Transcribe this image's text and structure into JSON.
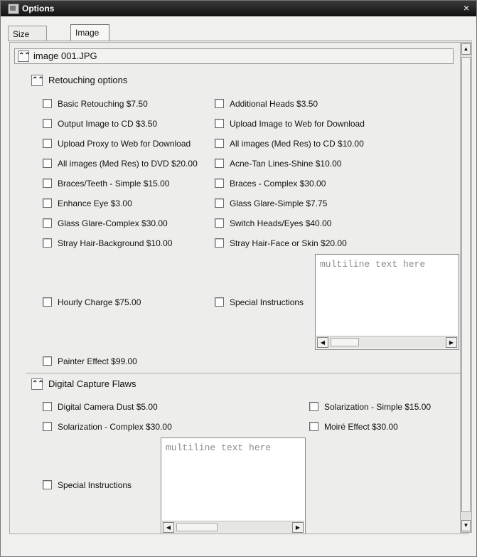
{
  "window": {
    "title": "Options",
    "close_symbol": "×"
  },
  "tabs": [
    {
      "label": "Size Options",
      "active": false
    },
    {
      "label": "Image Options",
      "active": true
    }
  ],
  "image_section": {
    "title": "image 001.JPG"
  },
  "retouching": {
    "title": "Retouching options",
    "left_options": [
      "Basic Retouching $7.50",
      "Output Image to CD $3.50",
      "Upload Proxy to Web for Download",
      "All images (Med Res) to DVD $20.00",
      "Braces/Teeth - Simple $15.00",
      "Enhance Eye $3.00",
      "Glass Glare-Complex $30.00",
      "Stray Hair-Background $10.00"
    ],
    "right_options": [
      "Additional Heads $3.50",
      "Upload Image to Web for Download",
      "All images (Med Res) to CD $10.00",
      "Acne-Tan Lines-Shine $10.00",
      "Braces - Complex $30.00",
      "Glass Glare-Simple $7.75",
      "Switch Heads/Eyes $40.00",
      "Stray Hair-Face or Skin $20.00"
    ],
    "hourly_charge": "Hourly Charge $75.00",
    "special_instructions": "Special Instructions",
    "special_placeholder": "multiline text here",
    "painter_effect": "Painter Effect $99.00"
  },
  "digital_capture": {
    "title": "Digital Capture Flaws",
    "options": [
      "Digital Camera Dust $5.00",
      "Solarization - Simple $15.00",
      "Solarization - Complex $30.00",
      "Moiré Effect $30.00"
    ],
    "special_instructions": "Special Instructions",
    "special_placeholder": "multiline text here"
  },
  "icons": {
    "collapse": "chevron-double-up-icon",
    "scroll_left": "arrow-left-icon",
    "scroll_right": "arrow-right-icon",
    "scroll_up": "arrow-up-icon",
    "scroll_down": "arrow-down-icon"
  }
}
